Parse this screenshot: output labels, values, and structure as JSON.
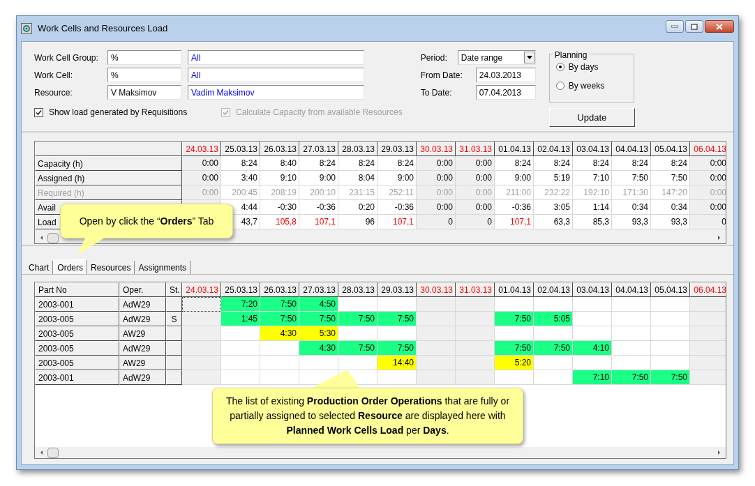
{
  "window": {
    "title": "Work Cells and Resources Load"
  },
  "filters": [
    {
      "label": "Work Cell Group:",
      "code": "%",
      "name": "All"
    },
    {
      "label": "Work Cell:",
      "code": "%",
      "name": "All"
    },
    {
      "label": "Resource:",
      "code": "V Maksimov",
      "name": "Vadim Maksimov"
    }
  ],
  "period": {
    "label": "Period:",
    "value": "Date range"
  },
  "from_date": {
    "label": "From Date:",
    "value": "24.03.2013"
  },
  "to_date": {
    "label": "To Date:",
    "value": "07.04.2013"
  },
  "planning": {
    "title": "Planning",
    "options": [
      {
        "label": "By days",
        "selected": true
      },
      {
        "label": "By weeks",
        "selected": false
      }
    ]
  },
  "update_button": "Update",
  "show_requisitions": {
    "label": "Show load generated by Requisitions",
    "checked": true,
    "disabled": false
  },
  "calculate_capacity": {
    "label": "Calculate Capacity from available Resources",
    "checked": true,
    "disabled": true
  },
  "summary": {
    "dates": [
      {
        "label": "24.03.13",
        "weekend": true
      },
      {
        "label": "25.03.13",
        "weekend": false
      },
      {
        "label": "26.03.13",
        "weekend": false
      },
      {
        "label": "27.03.13",
        "weekend": false
      },
      {
        "label": "28.03.13",
        "weekend": false
      },
      {
        "label": "29.03.13",
        "weekend": false
      },
      {
        "label": "30.03.13",
        "weekend": true
      },
      {
        "label": "31.03.13",
        "weekend": true
      },
      {
        "label": "01.04.13",
        "weekend": false
      },
      {
        "label": "02.04.13",
        "weekend": false
      },
      {
        "label": "03.04.13",
        "weekend": false
      },
      {
        "label": "04.04.13",
        "weekend": false
      },
      {
        "label": "05.04.13",
        "weekend": false
      },
      {
        "label": "06.04.13",
        "weekend": true
      }
    ],
    "rows": [
      {
        "label": "Capacity (h)",
        "disabled": false,
        "values": [
          {
            "text": "0:00",
            "over": false
          },
          {
            "text": "8:24",
            "over": false
          },
          {
            "text": "8:40",
            "over": false
          },
          {
            "text": "8:24",
            "over": false
          },
          {
            "text": "8:24",
            "over": false
          },
          {
            "text": "8:24",
            "over": false
          },
          {
            "text": "0:00",
            "over": false
          },
          {
            "text": "0:00",
            "over": false
          },
          {
            "text": "8:24",
            "over": false
          },
          {
            "text": "8:24",
            "over": false
          },
          {
            "text": "8:24",
            "over": false
          },
          {
            "text": "8:24",
            "over": false
          },
          {
            "text": "8:24",
            "over": false
          },
          {
            "text": "0:00",
            "over": false
          }
        ]
      },
      {
        "label": "Assigned (h)",
        "disabled": false,
        "values": [
          {
            "text": "0:00",
            "over": false
          },
          {
            "text": "3:40",
            "over": false
          },
          {
            "text": "9:10",
            "over": false
          },
          {
            "text": "9:00",
            "over": false
          },
          {
            "text": "8:04",
            "over": false
          },
          {
            "text": "9:00",
            "over": false
          },
          {
            "text": "0:00",
            "over": false
          },
          {
            "text": "0:00",
            "over": false
          },
          {
            "text": "9:00",
            "over": false
          },
          {
            "text": "5:19",
            "over": false
          },
          {
            "text": "7:10",
            "over": false
          },
          {
            "text": "7:50",
            "over": false
          },
          {
            "text": "7:50",
            "over": false
          },
          {
            "text": "0:00",
            "over": false
          }
        ]
      },
      {
        "label": "Required (h)",
        "disabled": true,
        "values": [
          {
            "text": "0:00",
            "over": false
          },
          {
            "text": "200:45",
            "over": false
          },
          {
            "text": "208:19",
            "over": false
          },
          {
            "text": "200:10",
            "over": false
          },
          {
            "text": "231:15",
            "over": false
          },
          {
            "text": "252:11",
            "over": false
          },
          {
            "text": "0:00",
            "over": false
          },
          {
            "text": "0:00",
            "over": false
          },
          {
            "text": "211:00",
            "over": false
          },
          {
            "text": "232:22",
            "over": false
          },
          {
            "text": "192:10",
            "over": false
          },
          {
            "text": "171:30",
            "over": false
          },
          {
            "text": "147:20",
            "over": false
          },
          {
            "text": "0:00",
            "over": false
          }
        ]
      },
      {
        "label": "Avail",
        "disabled": false,
        "values": [
          {
            "text": "4:44",
            "over": false
          },
          {
            "text": "-0:30",
            "over": false
          },
          {
            "text": "-0:36",
            "over": false
          },
          {
            "text": "0:20",
            "over": false
          },
          {
            "text": "-0:36",
            "over": false
          },
          {
            "text": "0:00",
            "over": false
          },
          {
            "text": "0:00",
            "over": false
          },
          {
            "text": "-0:36",
            "over": false
          },
          {
            "text": "3:05",
            "over": false
          },
          {
            "text": "1:14",
            "over": false
          },
          {
            "text": "0:34",
            "over": false
          },
          {
            "text": "0:34",
            "over": false
          },
          {
            "text": "0:00",
            "over": false
          }
        ]
      },
      {
        "label": "Load",
        "disabled": false,
        "values": [
          {
            "text": "43,7",
            "over": false
          },
          {
            "text": "105,8",
            "over": true
          },
          {
            "text": "107,1",
            "over": true
          },
          {
            "text": "96",
            "over": false
          },
          {
            "text": "107,1",
            "over": true
          },
          {
            "text": "0",
            "over": false
          },
          {
            "text": "0",
            "over": false
          },
          {
            "text": "107,1",
            "over": true
          },
          {
            "text": "63,3",
            "over": false
          },
          {
            "text": "85,3",
            "over": false
          },
          {
            "text": "93,3",
            "over": false
          },
          {
            "text": "93,3",
            "over": false
          },
          {
            "text": "0",
            "over": false
          }
        ]
      }
    ]
  },
  "tabs": [
    {
      "label": "Chart",
      "selected": false
    },
    {
      "label": "Orders",
      "selected": true
    },
    {
      "label": "Resources",
      "selected": false
    },
    {
      "label": "Assignments",
      "selected": false
    }
  ],
  "orders": {
    "columns": [
      "Part No",
      "Oper.",
      "St."
    ],
    "dates": [
      {
        "label": "24.03.13",
        "weekend": true
      },
      {
        "label": "25.03.13",
        "weekend": false
      },
      {
        "label": "26.03.13",
        "weekend": false
      },
      {
        "label": "27.03.13",
        "weekend": false
      },
      {
        "label": "28.03.13",
        "weekend": false
      },
      {
        "label": "29.03.13",
        "weekend": false
      },
      {
        "label": "30.03.13",
        "weekend": true
      },
      {
        "label": "31.03.13",
        "weekend": true
      },
      {
        "label": "01.04.13",
        "weekend": false
      },
      {
        "label": "02.04.13",
        "weekend": false
      },
      {
        "label": "03.04.13",
        "weekend": false
      },
      {
        "label": "04.04.13",
        "weekend": false
      },
      {
        "label": "05.04.13",
        "weekend": false
      },
      {
        "label": "06.04.13",
        "weekend": true
      }
    ],
    "rows": [
      {
        "part": "2003-001",
        "oper": "AdW29",
        "cells": [
          {
            "focused": true
          },
          {
            "time": "7:20",
            "color": "#1aff86"
          },
          {
            "time": "7:50",
            "color": "#1aff86"
          },
          {
            "time": "4:50",
            "color": "#1aff86"
          },
          null,
          null,
          null,
          null,
          null,
          null,
          null,
          null,
          null,
          null
        ]
      },
      {
        "part": "2003-005",
        "oper": "AdW29",
        "status": "S",
        "cells": [
          null,
          {
            "time": "1:45",
            "color": "#1aff86"
          },
          {
            "time": "7:50",
            "color": "#1aff86"
          },
          {
            "time": "7:50",
            "color": "#1aff86"
          },
          {
            "time": "7:50",
            "color": "#1aff86"
          },
          {
            "time": "7:50",
            "color": "#1aff86"
          },
          null,
          null,
          {
            "time": "7:50",
            "color": "#1aff86"
          },
          {
            "time": "5:05",
            "color": "#1aff86"
          },
          null,
          null,
          null,
          null
        ]
      },
      {
        "part": "2003-005",
        "oper": "AW29",
        "cells": [
          null,
          null,
          {
            "time": "4:30",
            "color": "#ffff00"
          },
          {
            "time": "5:30",
            "color": "#ffff00"
          },
          null,
          null,
          null,
          null,
          null,
          null,
          null,
          null,
          null,
          null
        ]
      },
      {
        "part": "2003-005",
        "oper": "AdW29",
        "cells": [
          null,
          null,
          null,
          {
            "time": "4:30",
            "color": "#1aff86"
          },
          {
            "time": "7:50",
            "color": "#1aff86"
          },
          {
            "time": "7:50",
            "color": "#1aff86"
          },
          null,
          null,
          {
            "time": "7:50",
            "color": "#1aff86"
          },
          {
            "time": "7:50",
            "color": "#1aff86"
          },
          {
            "time": "4:10",
            "color": "#1aff86"
          },
          null,
          null,
          null
        ]
      },
      {
        "part": "2003-005",
        "oper": "AW29",
        "cells": [
          null,
          null,
          null,
          null,
          null,
          {
            "time": "14:40",
            "color": "#ffff00"
          },
          null,
          null,
          {
            "time": "5:20",
            "color": "#ffff00"
          },
          null,
          null,
          null,
          null,
          null
        ]
      },
      {
        "part": "2003-001",
        "oper": "AdW29",
        "cells": [
          null,
          null,
          null,
          null,
          null,
          null,
          null,
          null,
          null,
          null,
          {
            "time": "7:10",
            "color": "#1aff86"
          },
          {
            "time": "7:50",
            "color": "#1aff86"
          },
          {
            "time": "7:50",
            "color": "#1aff86"
          },
          null
        ]
      }
    ]
  },
  "callouts": [
    {
      "text": "Open by click the “**Orders**” Tab"
    },
    {
      "text": "The list of existing **Production Order Operations** that are fully or partially assigned to selected **Resource** are displayed here with **Planned Work Cells Load** per **Days**."
    }
  ]
}
